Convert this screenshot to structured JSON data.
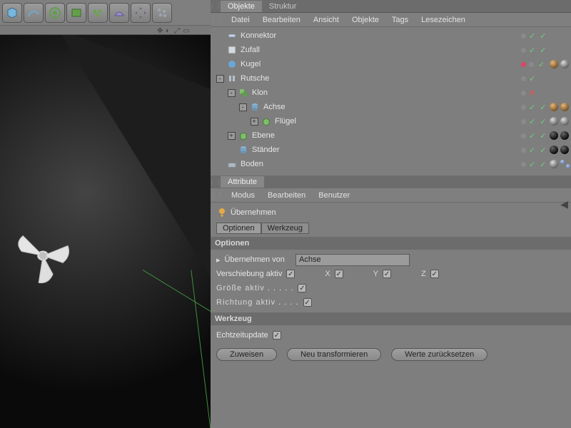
{
  "tabs_top": {
    "objects": "Objekte",
    "structure": "Struktur"
  },
  "menu_top": [
    "Datei",
    "Bearbeiten",
    "Ansicht",
    "Objekte",
    "Tags",
    "Lesezeichen"
  ],
  "tree": [
    {
      "name": "Konnektor",
      "icon": "link",
      "depth": 0,
      "exp": "",
      "vis": "d",
      "double": true,
      "tags": []
    },
    {
      "name": "Zufall",
      "icon": "dice",
      "depth": 0,
      "exp": "",
      "vis": "d",
      "double": true,
      "tags": []
    },
    {
      "name": "Kugel",
      "icon": "sphere-blue",
      "depth": 0,
      "exp": "",
      "vis": "r",
      "double": true,
      "tags": [
        "brown",
        "grey"
      ]
    },
    {
      "name": "Rutsche",
      "icon": "rig",
      "depth": 0,
      "exp": "-",
      "vis": "d",
      "tags": []
    },
    {
      "name": "Klon",
      "icon": "clone-green",
      "depth": 1,
      "exp": "-",
      "vis": "x",
      "tags": []
    },
    {
      "name": "Achse",
      "icon": "cylinder",
      "depth": 2,
      "exp": "-",
      "vis": "d",
      "double": true,
      "tags": [
        "brown",
        "brown",
        "mol"
      ]
    },
    {
      "name": "Flügel",
      "icon": "cube-green",
      "depth": 3,
      "exp": "+",
      "vis": "d",
      "double": true,
      "tags": [
        "grey",
        "grey",
        "mol",
        "mol"
      ]
    },
    {
      "name": "Ebene",
      "icon": "cube-green",
      "depth": 1,
      "exp": "+",
      "vis": "d",
      "double": true,
      "tags": [
        "dark",
        "dark",
        "mol"
      ]
    },
    {
      "name": "Ständer",
      "icon": "cylinder",
      "depth": 1,
      "exp": "",
      "vis": "d",
      "double": true,
      "tags": [
        "dark",
        "dark",
        "mol"
      ]
    },
    {
      "name": "Boden",
      "icon": "grid",
      "depth": 0,
      "exp": "",
      "vis": "d",
      "double": true,
      "tags": [
        "grey",
        "mol"
      ]
    }
  ],
  "attr_title": "Attribute",
  "menu_attr": [
    "Modus",
    "Bearbeiten",
    "Benutzer"
  ],
  "attr_header": "Übernehmen",
  "attr_tabs": [
    "Optionen",
    "Werkzeug"
  ],
  "sec1": "Optionen",
  "inherit_label": "Übernehmen von",
  "inherit_value": "Achse",
  "trans_label": "Verschiebung aktiv",
  "axes": {
    "x": "X",
    "y": "Y",
    "z": "Z"
  },
  "size_label": "Größe aktiv",
  "dir_label": "Richtung aktiv",
  "sec2": "Werkzeug",
  "rt_label": "Echtzeitupdate",
  "buttons": {
    "assign": "Zuweisen",
    "retrans": "Neu transformieren",
    "reset": "Werte zurücksetzen"
  }
}
